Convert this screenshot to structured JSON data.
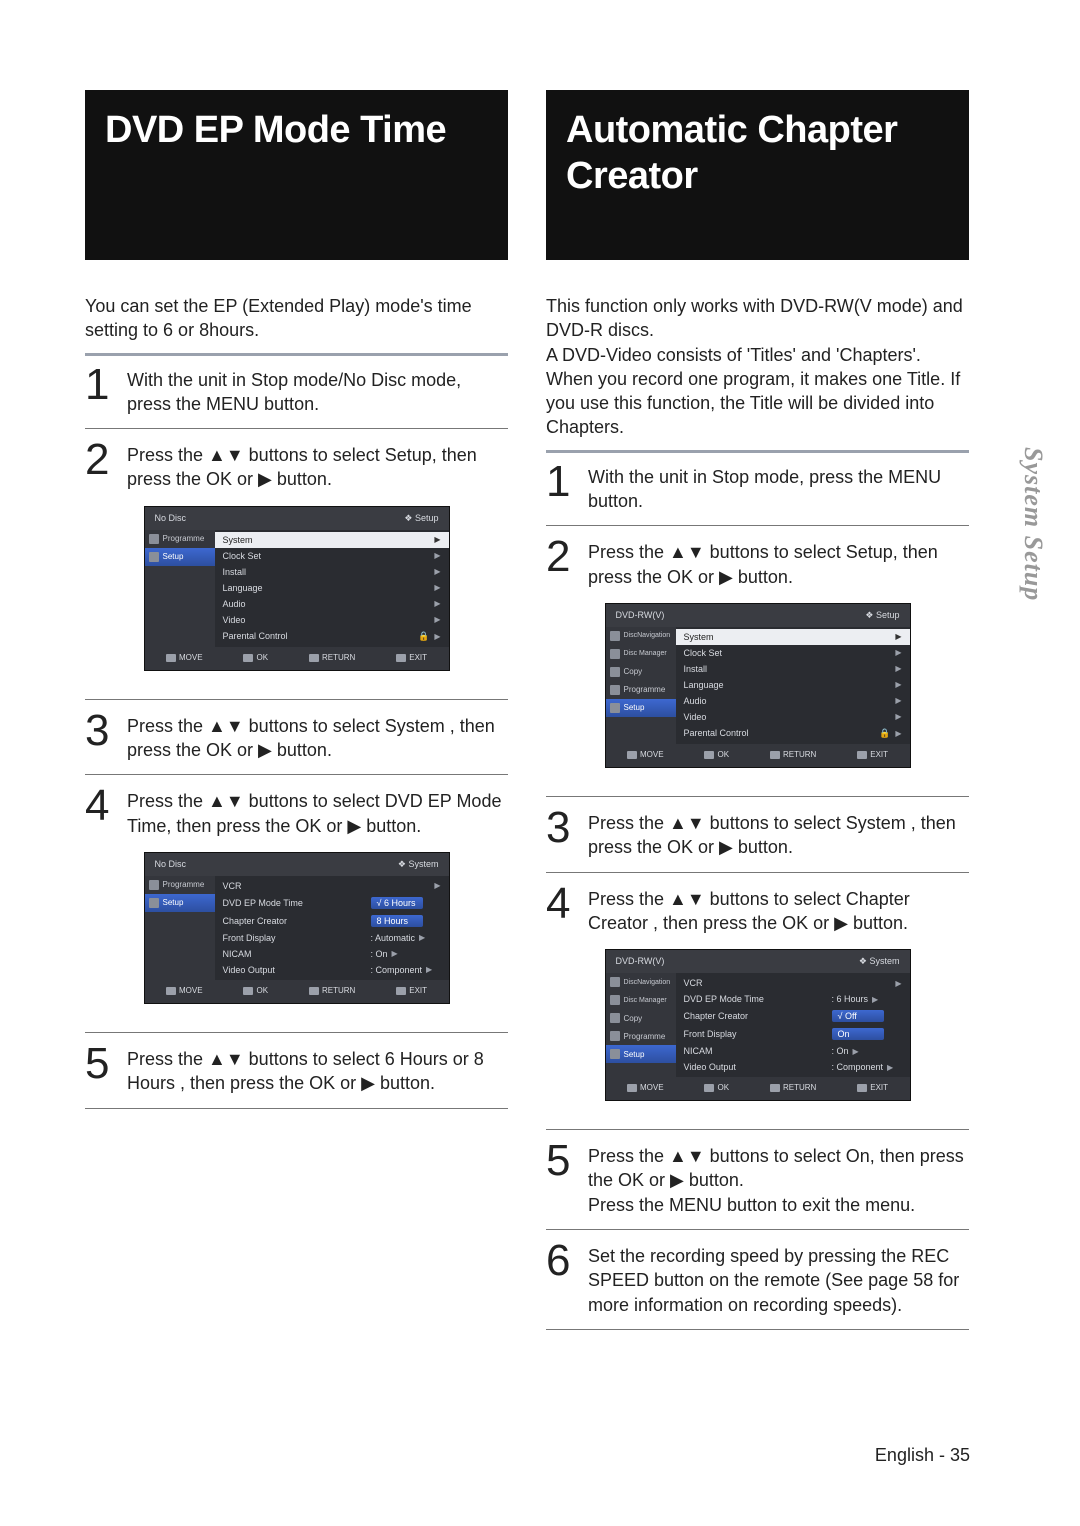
{
  "left": {
    "title": "DVD EP Mode Time",
    "intro": "You can set the EP (Extended Play) mode's time setting to 6 or 8hours.",
    "steps": [
      "With the unit in Stop mode/No Disc mode, press the MENU button.",
      "Press the ▲▼ buttons to select Setup, then press the OK or ▶ button.",
      "Press the ▲▼ buttons to select System , then press the OK or ▶ button.",
      "Press the  ▲▼ buttons to select DVD EP Mode Time, then press the OK or ▶ button.",
      "Press the ▲▼ buttons to select 6 Hours  or 8 Hours , then press the OK or ▶ button."
    ],
    "osd1": {
      "headerLeft": "No Disc",
      "headerRight": "❖  Setup",
      "side": [
        "Programme",
        "Setup"
      ],
      "sideSel": 1,
      "menu": [
        {
          "label": "System",
          "sel": true
        },
        {
          "label": "Clock Set"
        },
        {
          "label": "Install"
        },
        {
          "label": "Language"
        },
        {
          "label": "Audio"
        },
        {
          "label": "Video"
        },
        {
          "label": "Parental Control",
          "lock": true
        }
      ],
      "footer": [
        "MOVE",
        "OK",
        "RETURN",
        "EXIT"
      ]
    },
    "osd2": {
      "headerLeft": "No Disc",
      "headerRight": "❖  System",
      "side": [
        "Programme",
        "Setup"
      ],
      "sideSel": 1,
      "menu": [
        {
          "label": "VCR"
        },
        {
          "label": "DVD EP Mode Time",
          "valbox": "√ 6 Hours",
          "sel": true
        },
        {
          "label": "Chapter Creator",
          "valbox": "8 Hours"
        },
        {
          "label": "Front Display",
          "val": ": Automatic"
        },
        {
          "label": "NICAM",
          "val": ": On"
        },
        {
          "label": "Video Output",
          "val": ":  Component"
        }
      ],
      "footer": [
        "MOVE",
        "OK",
        "RETURN",
        "EXIT"
      ]
    }
  },
  "right": {
    "title": "Automatic Chapter Creator",
    "intro": "This function only works with DVD-RW(V mode) and DVD-R discs.\nA DVD-Video consists of 'Titles' and 'Chapters'. When you record one program, it makes one Title. If you use this function, the Title will be divided into Chapters.",
    "steps": [
      "With the unit in Stop mode, press the MENU button.",
      "Press the ▲▼ buttons to select Setup, then press the OK or ▶ button.",
      "Press the ▲▼ buttons to select System , then press the OK or ▶ button.",
      "Press the ▲▼ buttons to select Chapter Creator , then press the OK or ▶ button.",
      "Press the ▲▼ buttons to select On, then press the OK or ▶ button.\nPress the MENU button to exit the menu.",
      "Set the recording speed by pressing the REC SPEED button on the remote (See page 58 for more information on recording speeds)."
    ],
    "osd1": {
      "headerLeft": "DVD-RW(V)",
      "headerRight": "❖   Setup",
      "side": [
        "DiscNavigation",
        "Disc Manager",
        "Copy",
        "Programme",
        "Setup"
      ],
      "sideSel": 4,
      "menu": [
        {
          "label": "System",
          "sel": true
        },
        {
          "label": "Clock Set"
        },
        {
          "label": "Install"
        },
        {
          "label": "Language"
        },
        {
          "label": "Audio"
        },
        {
          "label": "Video"
        },
        {
          "label": "Parental Control",
          "lock": true
        }
      ],
      "footer": [
        "MOVE",
        "OK",
        "RETURN",
        "EXIT"
      ]
    },
    "osd2": {
      "headerLeft": "DVD-RW(V)",
      "headerRight": "❖   System",
      "side": [
        "DiscNavigation",
        "Disc Manager",
        "Copy",
        "Programme",
        "Setup"
      ],
      "sideSel": 4,
      "menu": [
        {
          "label": "VCR"
        },
        {
          "label": "DVD EP Mode Time",
          "val": ": 6 Hours"
        },
        {
          "label": "Chapter Creator",
          "valbox": "√ Off",
          "sel": true
        },
        {
          "label": "Front Display",
          "valbox": "On"
        },
        {
          "label": "NICAM",
          "val": ": On"
        },
        {
          "label": "Video Output",
          "val": ":   Component"
        }
      ],
      "footer": [
        "MOVE",
        "OK",
        "RETURN",
        "EXIT"
      ]
    }
  },
  "sideTab": "System Setup",
  "footer": {
    "lang": "English -",
    "page": "35"
  },
  "chart_data": null
}
